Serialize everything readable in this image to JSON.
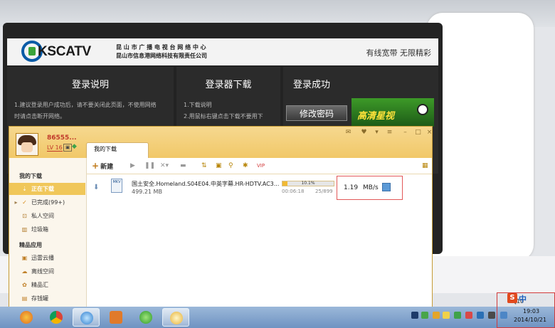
{
  "website": {
    "logo_text": "KSCATV",
    "logo_sub1": "昆 山 市 广 播 电 视 台 网 络 中 心",
    "logo_sub2": "昆山市信息港网络科技有限责任公司",
    "slogan": "有线宽带  无限精彩",
    "panels": [
      {
        "title": "登录说明",
        "lines": [
          "1.建议登录用户成功后，请不要关闭此页面，不使用网络",
          "时请点击断开网络。"
        ]
      },
      {
        "title": "登录器下载",
        "lines": [
          "1.下载说明",
          "2.用鼠标右键点击下载不要用下"
        ]
      },
      {
        "title": "登录成功",
        "lines": []
      }
    ],
    "change_password": "修改密码",
    "banner_text": "高清星视"
  },
  "downloader": {
    "username": "86555...",
    "level": "LV 16",
    "tab": "我的下载",
    "sidebar": {
      "section1": "我的下载",
      "items": [
        {
          "label": "正在下载",
          "icon": "download-icon"
        },
        {
          "label": "已完成(99+)",
          "icon": "check-icon"
        },
        {
          "label": "私人空间",
          "icon": "lock-icon"
        },
        {
          "label": "垃圾箱",
          "icon": "trash-icon"
        }
      ],
      "section2": "精品应用",
      "apps": [
        {
          "label": "迅雷云播",
          "icon": "cloud-play-icon"
        },
        {
          "label": "离线空间",
          "icon": "offline-icon"
        },
        {
          "label": "精品汇",
          "icon": "gift-icon"
        },
        {
          "label": "存钱罐",
          "icon": "piggy-bank-icon"
        }
      ]
    },
    "toolbar": {
      "new": "新建"
    },
    "task": {
      "name": "国土安全.Homeland.S04E04.中英字幕.HR-HDTV.AC3...",
      "size": "499.21 MB",
      "progress_pct": 10.1,
      "progress_text": "10.1%",
      "elapsed": "00:06:18",
      "pieces": "25/899",
      "speed": "1.19",
      "speed_unit": "MB/s"
    }
  },
  "taskbar": {
    "zoom": "10",
    "ime_logo": "S",
    "ime_lang": "中",
    "time": "19:03",
    "date": "2014/10/21"
  }
}
